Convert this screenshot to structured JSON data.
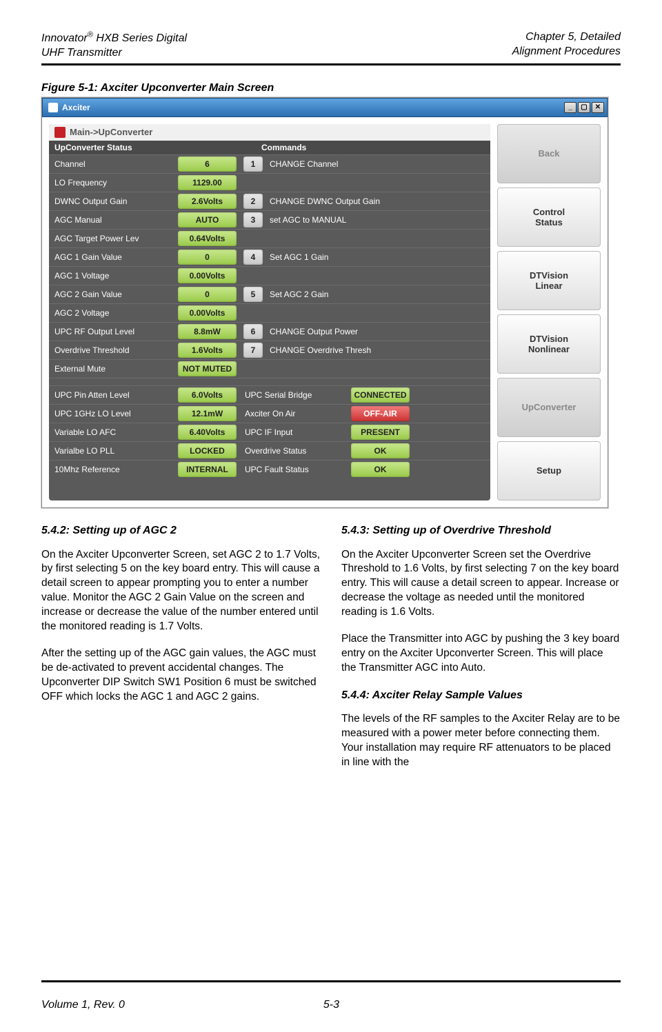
{
  "header": {
    "left_line1": "Innovator",
    "left_sup": "®",
    "left_line1_rest": " HXB Series Digital",
    "left_line2": "UHF Transmitter",
    "right_line1": "Chapter 5, Detailed",
    "right_line2": "Alignment Procedures"
  },
  "figure": {
    "caption": "Figure 5-1: Axciter Upconverter Main Screen",
    "window_title": "Axciter",
    "breadcrumb": "Main->UpConverter",
    "col_header1": "UpConverter Status",
    "col_header2": "Commands",
    "status_top": [
      {
        "label": "Channel",
        "value": "6",
        "cmd_num": "1",
        "cmd_label": "CHANGE Channel"
      },
      {
        "label": "LO Frequency",
        "value": "1129.00",
        "cmd_num": "",
        "cmd_label": ""
      },
      {
        "label": "DWNC Output Gain",
        "value": "2.6Volts",
        "cmd_num": "2",
        "cmd_label": "CHANGE DWNC Output Gain"
      },
      {
        "label": "AGC Manual",
        "value": "AUTO",
        "cmd_num": "3",
        "cmd_label": "set AGC to MANUAL"
      },
      {
        "label": "AGC Target Power Lev",
        "value": "0.64Volts",
        "cmd_num": "",
        "cmd_label": ""
      },
      {
        "label": "AGC 1 Gain Value",
        "value": "0",
        "cmd_num": "4",
        "cmd_label": "Set AGC 1 Gain"
      },
      {
        "label": "AGC 1 Voltage",
        "value": "0.00Volts",
        "cmd_num": "",
        "cmd_label": ""
      },
      {
        "label": "AGC 2 Gain Value",
        "value": "0",
        "cmd_num": "5",
        "cmd_label": "Set AGC 2 Gain"
      },
      {
        "label": "AGC 2 Voltage",
        "value": "0.00Volts",
        "cmd_num": "",
        "cmd_label": ""
      },
      {
        "label": "UPC RF Output Level",
        "value": "8.8mW",
        "cmd_num": "6",
        "cmd_label": "CHANGE Output Power"
      },
      {
        "label": "Overdrive Threshold",
        "value": "1.6Volts",
        "cmd_num": "7",
        "cmd_label": "CHANGE Overdrive Thresh"
      },
      {
        "label": "External Mute",
        "value": "NOT MUTED",
        "cmd_num": "",
        "cmd_label": ""
      }
    ],
    "status_bottom": [
      {
        "l": "UPC Pin Atten Level",
        "lv": "6.0Volts",
        "r": "UPC Serial Bridge",
        "rv": "CONNECTED",
        "rv_red": false
      },
      {
        "l": "UPC 1GHz LO Level",
        "lv": "12.1mW",
        "r": "Axciter On Air",
        "rv": "OFF-AIR",
        "rv_red": true
      },
      {
        "l": "Variable LO AFC",
        "lv": "6.40Volts",
        "r": "UPC IF Input",
        "rv": "PRESENT",
        "rv_red": false
      },
      {
        "l": "Varialbe LO PLL",
        "lv": "LOCKED",
        "r": "Overdrive Status",
        "rv": "OK",
        "rv_red": false
      },
      {
        "l": "10Mhz Reference",
        "lv": "INTERNAL",
        "r": "UPC Fault Status",
        "rv": "OK",
        "rv_red": false
      }
    ],
    "side_tabs": [
      {
        "label": "Back",
        "dim": true
      },
      {
        "label": "Control\nStatus",
        "dim": false
      },
      {
        "label": "DTVision\nLinear",
        "dim": false
      },
      {
        "label": "DTVision\nNonlinear",
        "dim": false
      },
      {
        "label": "UpConverter",
        "dim": true
      },
      {
        "label": "Setup",
        "dim": false
      }
    ]
  },
  "body": {
    "s542_h": "5.4.2: Setting up of AGC 2",
    "s542_p1": "On the Axciter Upconverter Screen, set AGC 2 to 1.7 Volts, by first selecting 5 on the key board entry.  This will cause a detail screen to appear prompting you to enter a number value.  Monitor the AGC 2 Gain Value on the screen and increase or decrease the value of the number entered until the monitored reading is 1.7 Volts.",
    "s542_p2": "After the setting up of the AGC gain values, the AGC must be de-activated to prevent accidental changes.  The Upconverter DIP Switch SW1 Position 6 must be switched OFF which locks the AGC 1 and AGC 2 gains.",
    "s543_h": "5.4.3: Setting up of Overdrive Threshold",
    "s543_p1": "On the Axciter Upconverter Screen set the Overdrive Threshold to 1.6 Volts, by first selecting 7 on the key board entry.  This will cause a detail screen to appear.  Increase or decrease the voltage as needed until the monitored reading is 1.6 Volts.",
    "s543_p2": "Place the Transmitter into AGC by pushing the 3 key board entry on the Axciter Upconverter Screen.  This will place the Transmitter AGC into Auto.",
    "s544_h": "5.4.4: Axciter Relay Sample Values",
    "s544_p1": "The levels of the RF samples to the Axciter Relay are to be measured with a power meter before connecting them.  Your installation may require RF attenuators to be placed in line with the"
  },
  "footer": {
    "left": "Volume 1, Rev. 0",
    "center": "5-3"
  }
}
